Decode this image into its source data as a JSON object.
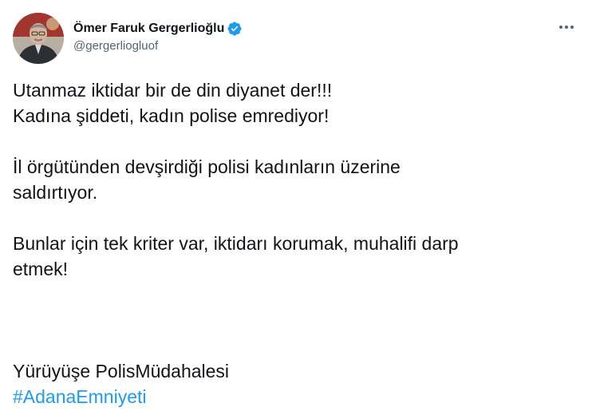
{
  "author": {
    "display_name": "Ömer Faruk Gergerlioğlu",
    "handle": "@gergerliogluof",
    "verified": true
  },
  "tweet": {
    "paragraphs": [
      [
        "Utanmaz iktidar bir de din diyanet der!!!",
        "Kadına şiddeti, kadın polise emrediyor!"
      ],
      [
        "İl örgütünden devşirdiği polisi kadınların üzerine",
        "saldırtıyor."
      ],
      [
        "Bunlar için tek kriter var, iktidarı korumak, muhalifi darp",
        "etmek!"
      ]
    ],
    "closing_line": "Yürüyüşe PolisMüdahalesi",
    "hashtag": "#AdanaEmniyeti"
  },
  "colors": {
    "text": "#0f1419",
    "secondary": "#536471",
    "accent": "#1d9bf0"
  },
  "icons": {
    "verified": "verified-badge-icon",
    "more": "more-options-icon"
  }
}
